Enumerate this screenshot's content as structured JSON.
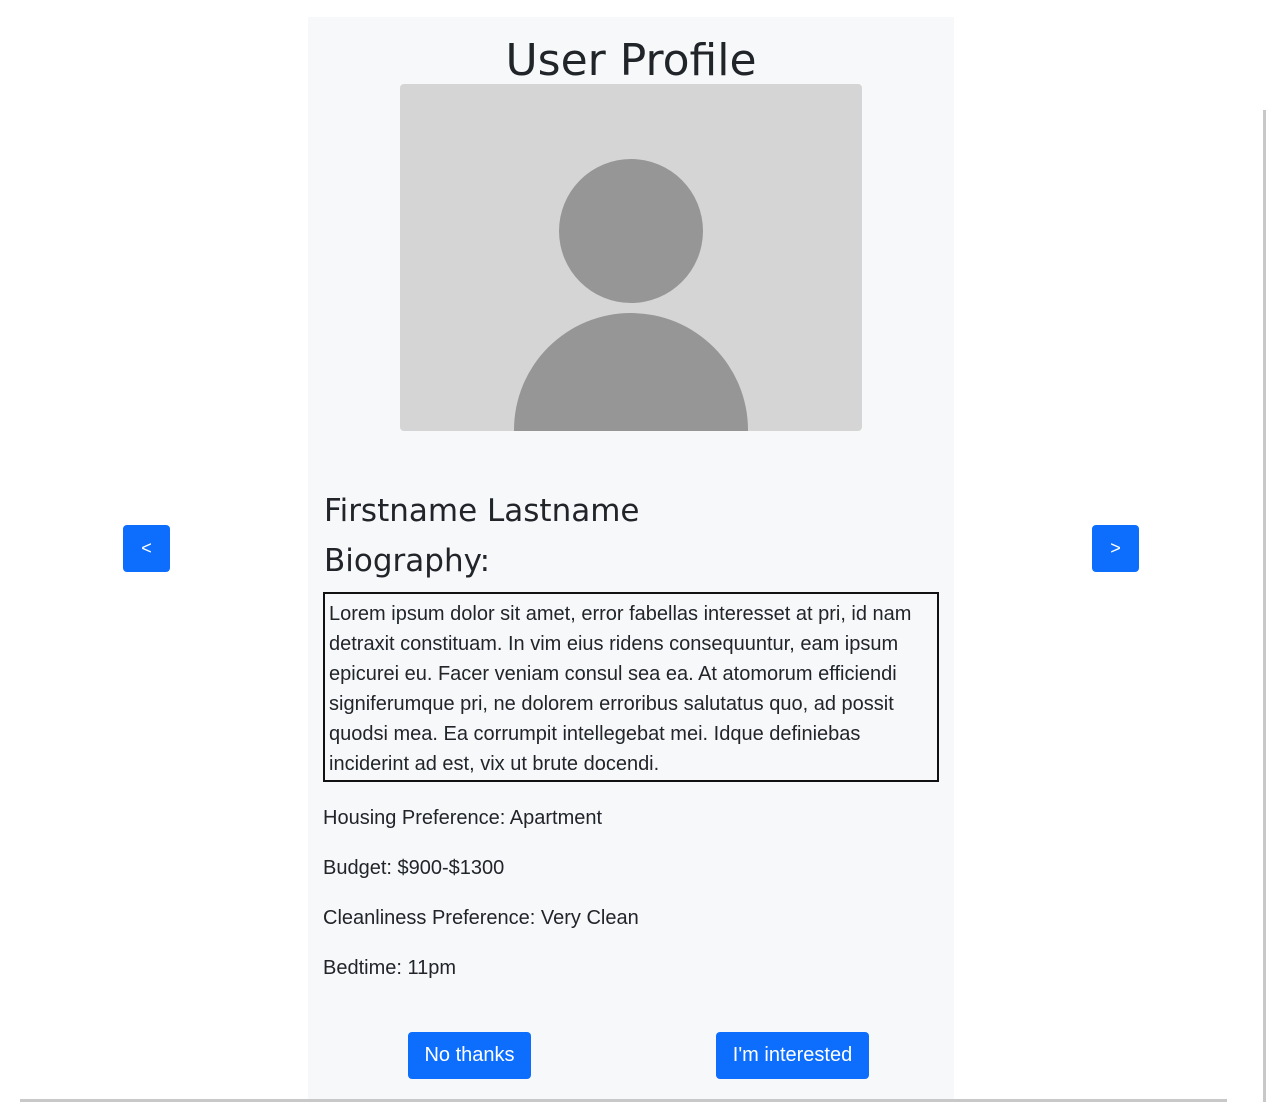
{
  "page": {
    "title": "User Profile"
  },
  "profile": {
    "name": "Firstname Lastname",
    "bio_heading": "Biography:",
    "bio_text": "Lorem ipsum dolor sit amet, error fabellas interesset at pri, id nam detraxit constituam. In vim eius ridens consequuntur, eam ipsum epicurei eu. Facer veniam consul sea ea. At atomorum efficiendi signiferumque pri, ne dolorem erroribus salutatus quo, ad possit quodsi mea. Ea corrumpit intellegebat mei. Idque definiebas inciderint ad est, vix ut brute docendi.",
    "housing": "Housing Preference: Apartment",
    "budget": "Budget: $900-$1300",
    "cleanliness": "Cleanliness Preference: Very Clean",
    "bedtime": "Bedtime: 11pm",
    "avatar_icon": "user-placeholder-icon"
  },
  "actions": {
    "decline_label": "No thanks",
    "accept_label": "I'm interested"
  },
  "navigation": {
    "prev_label": "<",
    "next_label": ">"
  },
  "colors": {
    "primary": "#0d6efd",
    "card_background": "#f7f8fa",
    "avatar_background": "#d5d5d5",
    "avatar_silhouette": "#969696"
  }
}
